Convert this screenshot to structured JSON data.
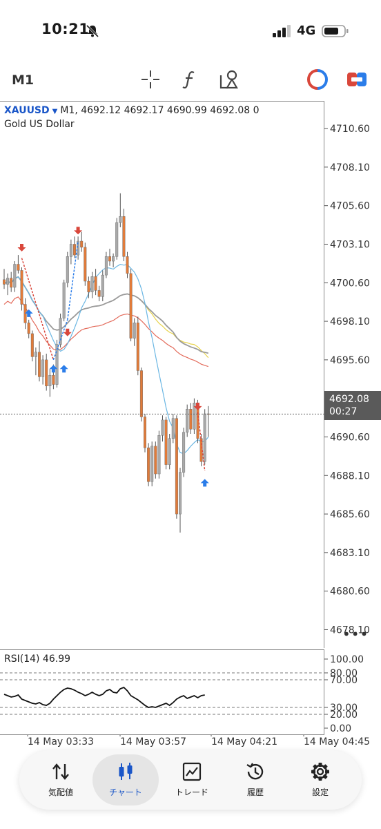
{
  "status": {
    "time": "10:21",
    "network": "4G"
  },
  "toolbar": {
    "timeframe": "M1",
    "icons": [
      "crosshair-icon",
      "function-icon",
      "objects-icon",
      "trade-signals-icon",
      "one-click-icon"
    ]
  },
  "chart": {
    "symbol": "XAUUSD",
    "timeframe_label": "M1,",
    "ohlc": "4692.12 4692.17 4690.99 4692.08 0",
    "description": "Gold US Dollar",
    "price_levels": [
      "4710.60",
      "4708.10",
      "4705.60",
      "4703.10",
      "4700.60",
      "4698.10",
      "4695.60",
      "4693.10",
      "4690.60",
      "4688.10",
      "4685.60",
      "4683.10",
      "4680.60",
      "4678.10"
    ],
    "current_price": "4692.08",
    "countdown": "00:27",
    "colors": {
      "bull": "#a9a9a9",
      "bear": "#e07b3a",
      "buy_arrow": "#2b7de9",
      "sell_arrow": "#d9473b",
      "ma_fast": "#6ab6e3",
      "ma_mid": "#e8d44d",
      "ma_slow": "#9a9a9a",
      "ma_long": "#e36a5a"
    }
  },
  "rsi": {
    "label": "RSI(14) 46.99",
    "levels": [
      "100.00",
      "80.00",
      "70.00",
      "30.00",
      "20.00",
      "0.00"
    ]
  },
  "time_axis": [
    "14 May 03:33",
    "14 May 03:57",
    "14 May 04:21",
    "14 May 04:45"
  ],
  "more_icon": "•••",
  "bottom_nav": [
    {
      "label": "気配値",
      "icon": "quotes-icon"
    },
    {
      "label": "チャート",
      "icon": "chart-candles-icon",
      "active": true
    },
    {
      "label": "トレード",
      "icon": "trade-icon"
    },
    {
      "label": "履歴",
      "icon": "history-icon"
    },
    {
      "label": "設定",
      "icon": "settings-icon"
    }
  ],
  "chart_data": {
    "type": "candlestick",
    "ylim": [
      4677.0,
      4711.5
    ],
    "candles": [
      [
        4700.8,
        4701.5,
        4700.2,
        4700.5
      ],
      [
        4700.5,
        4701.2,
        4699.8,
        4700.9
      ],
      [
        4700.9,
        4701.3,
        4700.0,
        4700.3
      ],
      [
        4700.3,
        4702.0,
        4700.0,
        4701.8
      ],
      [
        4701.8,
        4702.4,
        4701.2,
        4701.4
      ],
      [
        4701.4,
        4701.6,
        4698.8,
        4699.2
      ],
      [
        4699.2,
        4699.6,
        4697.6,
        4698.0
      ],
      [
        4698.0,
        4698.2,
        4697.0,
        4697.3
      ],
      [
        4697.3,
        4697.5,
        4695.5,
        4695.8
      ],
      [
        4695.8,
        4696.4,
        4694.6,
        4696.1
      ],
      [
        4696.1,
        4696.8,
        4694.2,
        4694.5
      ],
      [
        4694.5,
        4695.9,
        4694.0,
        4695.6
      ],
      [
        4695.6,
        4696.0,
        4693.6,
        4693.9
      ],
      [
        4693.9,
        4695.0,
        4693.2,
        4694.6
      ],
      [
        4694.6,
        4695.3,
        4693.7,
        4694.0
      ],
      [
        4694.0,
        4696.9,
        4693.8,
        4696.6
      ],
      [
        4696.6,
        4698.6,
        4696.4,
        4698.3
      ],
      [
        4698.3,
        4700.8,
        4698.1,
        4700.6
      ],
      [
        4700.6,
        4702.6,
        4700.3,
        4702.3
      ],
      [
        4702.3,
        4703.4,
        4701.8,
        4703.1
      ],
      [
        4703.1,
        4703.6,
        4702.2,
        4702.4
      ],
      [
        4702.4,
        4703.6,
        4702.1,
        4703.3
      ],
      [
        4703.3,
        4703.9,
        4702.6,
        4702.9
      ],
      [
        4702.9,
        4703.2,
        4700.4,
        4700.7
      ],
      [
        4700.7,
        4701.0,
        4699.6,
        4700.0
      ],
      [
        4700.0,
        4701.3,
        4699.6,
        4701.0
      ],
      [
        4701.0,
        4701.5,
        4699.8,
        4700.1
      ],
      [
        4700.1,
        4700.4,
        4699.4,
        4699.7
      ],
      [
        4699.7,
        4701.4,
        4699.4,
        4701.1
      ],
      [
        4701.1,
        4702.6,
        4700.9,
        4702.3
      ],
      [
        4702.3,
        4702.8,
        4701.7,
        4702.0
      ],
      [
        4702.0,
        4702.5,
        4701.6,
        4702.3
      ],
      [
        4702.3,
        4704.8,
        4702.1,
        4704.5
      ],
      [
        4704.5,
        4706.4,
        4704.2,
        4704.9
      ],
      [
        4704.9,
        4705.4,
        4702.0,
        4702.3
      ],
      [
        4702.3,
        4702.6,
        4700.9,
        4701.2
      ],
      [
        4701.2,
        4701.5,
        4696.8,
        4697.0
      ],
      [
        4697.0,
        4698.3,
        4696.5,
        4698.0
      ],
      [
        4698.0,
        4698.4,
        4694.6,
        4694.9
      ],
      [
        4694.9,
        4695.1,
        4691.6,
        4691.9
      ],
      [
        4691.9,
        4692.1,
        4689.6,
        4689.9
      ],
      [
        4689.9,
        4690.2,
        4687.4,
        4687.7
      ],
      [
        4687.7,
        4690.3,
        4687.4,
        4690.0
      ],
      [
        4690.0,
        4690.3,
        4687.9,
        4688.2
      ],
      [
        4688.2,
        4691.0,
        4687.9,
        4690.7
      ],
      [
        4690.7,
        4692.0,
        4690.3,
        4691.7
      ],
      [
        4691.7,
        4691.9,
        4688.5,
        4688.8
      ],
      [
        4688.8,
        4690.8,
        4688.5,
        4690.5
      ],
      [
        4690.5,
        4692.1,
        4690.2,
        4691.8
      ],
      [
        4691.8,
        4692.0,
        4685.3,
        4685.6
      ],
      [
        4685.6,
        4688.6,
        4684.4,
        4688.3
      ],
      [
        4688.3,
        4691.2,
        4688.0,
        4690.9
      ],
      [
        4690.9,
        4692.7,
        4690.6,
        4692.4
      ],
      [
        4692.4,
        4692.8,
        4690.8,
        4691.1
      ],
      [
        4691.1,
        4693.1,
        4690.8,
        4692.8
      ],
      [
        4692.8,
        4693.0,
        4690.2,
        4690.5
      ],
      [
        4690.5,
        4690.8,
        4688.7,
        4689.0
      ],
      [
        4689.0,
        4692.4,
        4688.8,
        4692.1
      ],
      [
        4692.1,
        4692.6,
        4690.6,
        4692.08
      ]
    ],
    "rsi_values": [
      49,
      47,
      45,
      46,
      48,
      42,
      40,
      38,
      36,
      35,
      37,
      34,
      33,
      36,
      42,
      47,
      52,
      56,
      58,
      57,
      55,
      52,
      50,
      47,
      49,
      52,
      49,
      47,
      49,
      54,
      56,
      52,
      51,
      57,
      59,
      54,
      47,
      44,
      41,
      37,
      33,
      30,
      31,
      30,
      32,
      34,
      36,
      33,
      37,
      42,
      45,
      47,
      43,
      45,
      47,
      44,
      47,
      48
    ],
    "rsi_levels": [
      100,
      80,
      70,
      30,
      20,
      0
    ]
  }
}
